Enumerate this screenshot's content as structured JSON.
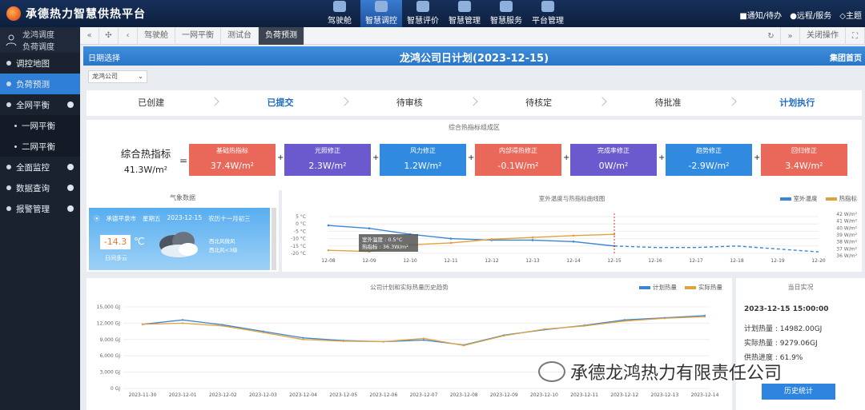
{
  "app": {
    "title": "承德热力智慧供热平台"
  },
  "nav": {
    "tabs": [
      {
        "label": "驾驶舱",
        "icon": "cockpit-icon",
        "active": false
      },
      {
        "label": "智慧调控",
        "icon": "control-icon",
        "active": true
      },
      {
        "label": "智慧评价",
        "icon": "evaluate-icon",
        "active": false
      },
      {
        "label": "智慧管理",
        "icon": "manage-icon",
        "active": false
      },
      {
        "label": "智慧服务",
        "icon": "service-icon",
        "active": false
      },
      {
        "label": "平台管理",
        "icon": "platform-icon",
        "active": false
      }
    ],
    "links": [
      "■通知/待办",
      "●远程/服务",
      "◇主题"
    ]
  },
  "user": {
    "name": "龙鸿调度",
    "sub": "负荷调度"
  },
  "sidebar": {
    "items": [
      {
        "label": "调控地图",
        "type": "item"
      },
      {
        "label": "负荷预测",
        "type": "active"
      },
      {
        "label": "全网平衡",
        "type": "group"
      },
      {
        "label": "一网平衡",
        "type": "sub"
      },
      {
        "label": "二网平衡",
        "type": "sub"
      },
      {
        "label": "全面监控",
        "type": "group"
      },
      {
        "label": "数据查询",
        "type": "group"
      },
      {
        "label": "报警管理",
        "type": "group"
      }
    ]
  },
  "pagetabs": [
    "驾驶舱",
    "一网平衡",
    "测试台",
    "负荷预测"
  ],
  "close_ops": "关闭操作",
  "header": {
    "left": "日期选择",
    "title": "龙鸿公司日计划(2023-12-15)",
    "right": "集团首页"
  },
  "company_select": "龙鸿公司",
  "steps": [
    {
      "label": "已创建",
      "hl": false
    },
    {
      "label": "已提交",
      "hl": true
    },
    {
      "label": "待审核",
      "hl": false
    },
    {
      "label": "待核定",
      "hl": false
    },
    {
      "label": "待批准",
      "hl": false
    },
    {
      "label": "计划执行",
      "hl": true
    }
  ],
  "composite": {
    "title": "综合热指标组成区",
    "total_label": "综合热指标",
    "total_value": "41.3W/m²",
    "eq": "=",
    "cards": [
      {
        "name": "基础热指标",
        "value": "37.4W/m²",
        "color": "#e9685a"
      },
      {
        "name": "光照修正",
        "value": "2.3W/m²",
        "color": "#6a5acd"
      },
      {
        "name": "风力修正",
        "value": "1.2W/m²",
        "color": "#2f8ae0"
      },
      {
        "name": "内部得热修正",
        "value": "-0.1W/m²",
        "color": "#e9685a"
      },
      {
        "name": "完成率修正",
        "value": "0W/m²",
        "color": "#6a5acd"
      },
      {
        "name": "趋势修正",
        "value": "-2.9W/m²",
        "color": "#2f8ae0"
      },
      {
        "name": "回归修正",
        "value": "3.4W/m²",
        "color": "#e9685a"
      }
    ]
  },
  "weather": {
    "title": "气象数据",
    "location": "承德平泉市",
    "weekday": "星期五",
    "date": "2023-12-15",
    "lunar": "农历十一月初三",
    "temp": "-14.3",
    "unit": "℃",
    "condition": "日间多云",
    "wind1": "西北风微风",
    "wind2": "西北风<3级"
  },
  "trend": {
    "title": "室外温度与热指标曲线图",
    "legend": [
      {
        "name": "室外温度",
        "color": "#3a86d4"
      },
      {
        "name": "热指标",
        "color": "#e0a23a"
      }
    ],
    "y_left": [
      "5 °C",
      "0 °C",
      "-5 °C",
      "-10 °C",
      "-15 °C",
      "-20 °C"
    ],
    "y_right": [
      "42 W/m²",
      "41 W/m²",
      "40 W/m²",
      "39 W/m²",
      "38 W/m²",
      "37 W/m²",
      "36 W/m²"
    ],
    "x": [
      "12-08",
      "12-09",
      "12-10",
      "12-11",
      "12-12",
      "12-13",
      "12-14",
      "12-15",
      "12-16",
      "12-17",
      "12-18",
      "12-19",
      "12-20"
    ],
    "tooltip_temp": "室外温度 : 0.5°C",
    "tooltip_idx": "热指标  : 36.3W/m²"
  },
  "hist": {
    "title": "公司计划和实际热量历史趋势",
    "legend": [
      {
        "name": "计划热量",
        "color": "#3a86d4"
      },
      {
        "name": "实际热量",
        "color": "#e0a23a"
      }
    ],
    "y": [
      "15,000 GJ",
      "12,000 GJ",
      "9,000 GJ",
      "6,000 GJ",
      "3,000 GJ",
      "0 GJ"
    ],
    "x": [
      "2023-11-30",
      "2023-12-01",
      "2023-12-02",
      "2023-12-03",
      "2023-12-04",
      "2023-12-05",
      "2023-12-06",
      "2023-12-07",
      "2023-12-08",
      "2023-12-09",
      "2023-12-10",
      "2023-12-11",
      "2023-12-12",
      "2023-12-13",
      "2023-12-14"
    ]
  },
  "today": {
    "title": "当日实况",
    "time": "2023-12-15 15:00:00",
    "plan": "计划热量 : 14982.00GJ",
    "actual": "实际热量 : 9279.06GJ",
    "progress": "供热进度 : 61.9%",
    "button": "历史统计"
  },
  "watermark": "承德龙鸿热力有限责任公司",
  "chart_data": [
    {
      "type": "line",
      "title": "室外温度与热指标曲线图",
      "x": [
        "12-08",
        "12-09",
        "12-10",
        "12-11",
        "12-12",
        "12-13",
        "12-14",
        "12-15",
        "12-16",
        "12-17",
        "12-18",
        "12-19",
        "12-20"
      ],
      "series": [
        {
          "name": "室外温度",
          "unit": "°C",
          "values": [
            -1,
            -3,
            -7,
            -10,
            -11,
            -11,
            -12,
            -15,
            -16,
            -16,
            -15,
            -17,
            -19
          ]
        },
        {
          "name": "热指标",
          "unit": "W/m²",
          "values": [
            36.5,
            36.3,
            37.4,
            37.7,
            38.3,
            38.6,
            38.9,
            39.1,
            null,
            null,
            null,
            null,
            null
          ]
        }
      ],
      "ylim_left": [
        -20,
        5
      ],
      "ylim_right": [
        36,
        42
      ]
    },
    {
      "type": "line",
      "title": "公司计划和实际热量历史趋势",
      "x": [
        "2023-11-30",
        "2023-12-01",
        "2023-12-02",
        "2023-12-03",
        "2023-12-04",
        "2023-12-05",
        "2023-12-06",
        "2023-12-07",
        "2023-12-08",
        "2023-12-09",
        "2023-12-10",
        "2023-12-11",
        "2023-12-12",
        "2023-12-13",
        "2023-12-14"
      ],
      "series": [
        {
          "name": "计划热量",
          "values": [
            11800,
            12600,
            11700,
            10500,
            9300,
            8800,
            8600,
            8900,
            8000,
            9800,
            10800,
            11600,
            12600,
            13000,
            13400
          ]
        },
        {
          "name": "实际热量",
          "values": [
            11800,
            12000,
            11500,
            10300,
            9000,
            8700,
            8600,
            9200,
            7900,
            9700,
            10900,
            11500,
            12400,
            12900,
            13200
          ]
        }
      ],
      "ylim": [
        0,
        15000
      ]
    }
  ]
}
